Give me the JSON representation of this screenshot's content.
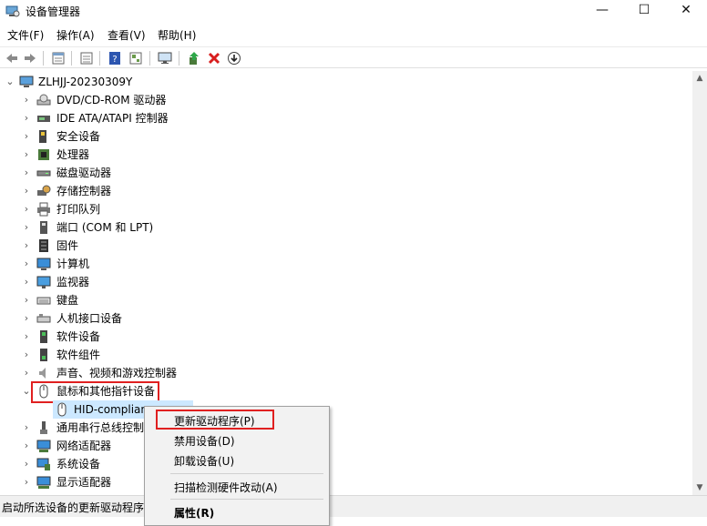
{
  "window": {
    "title": "设备管理器",
    "minimize": "—",
    "maximize": "☐",
    "close": "✕"
  },
  "menu": [
    {
      "label": "文件(F)"
    },
    {
      "label": "操作(A)"
    },
    {
      "label": "查看(V)"
    },
    {
      "label": "帮助(H)"
    }
  ],
  "toolbar": [
    "back-icon",
    "forward-icon",
    "properties-icon",
    "view-icon",
    "help-icon",
    "show-hidden-icon",
    "monitor-icon",
    "update-driver-icon",
    "uninstall-icon",
    "download-icon"
  ],
  "tree": {
    "root": "ZLHJJ-20230309Y",
    "items": [
      {
        "label": "DVD/CD-ROM 驱动器"
      },
      {
        "label": "IDE ATA/ATAPI 控制器"
      },
      {
        "label": "安全设备"
      },
      {
        "label": "处理器"
      },
      {
        "label": "磁盘驱动器"
      },
      {
        "label": "存储控制器"
      },
      {
        "label": "打印队列"
      },
      {
        "label": "端口 (COM 和 LPT)"
      },
      {
        "label": "固件"
      },
      {
        "label": "计算机"
      },
      {
        "label": "监视器"
      },
      {
        "label": "键盘"
      },
      {
        "label": "人机接口设备"
      },
      {
        "label": "软件设备"
      },
      {
        "label": "软件组件"
      },
      {
        "label": "声音、视频和游戏控制器"
      },
      {
        "label": "鼠标和其他指针设备"
      },
      {
        "label": "HID-complian"
      },
      {
        "label": "通用串行总线控制"
      },
      {
        "label": "网络适配器"
      },
      {
        "label": "系统设备"
      },
      {
        "label": "显示适配器"
      }
    ]
  },
  "context_menu": {
    "items": [
      {
        "label": "更新驱动程序(P)"
      },
      {
        "label": "禁用设备(D)"
      },
      {
        "label": "卸载设备(U)"
      },
      {
        "label": "扫描检测硬件改动(A)"
      },
      {
        "label": "属性(R)"
      }
    ]
  },
  "status": {
    "text": "启动所选设备的更新驱动程序"
  },
  "colors": {
    "highlight": "#e02020",
    "selection": "#cce8ff"
  }
}
